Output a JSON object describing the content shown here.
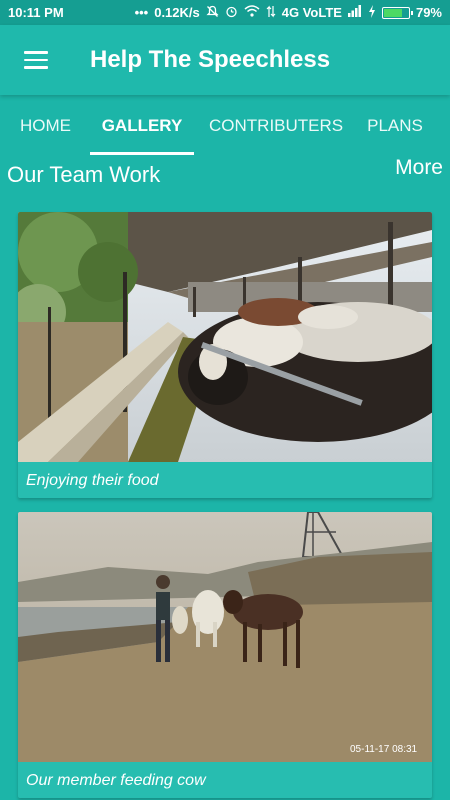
{
  "status_bar": {
    "time": "10:11 PM",
    "network_speed": "0.12K/s",
    "network_type": "4G VoLTE",
    "battery_percent": "79%",
    "battery_level": 0.79
  },
  "app_bar": {
    "title": "Help The Speechless",
    "menu_icon": "hamburger-menu-icon"
  },
  "tabs": [
    {
      "label": "HOME",
      "active": false
    },
    {
      "label": "GALLERY",
      "active": true
    },
    {
      "label": "CONTRIBUTERS",
      "active": false
    },
    {
      "label": "PLANS",
      "active": false
    }
  ],
  "gallery": {
    "section_title": "Our Team Work",
    "more_label": "More",
    "items": [
      {
        "caption": "Enjoying their food"
      },
      {
        "caption": "Our member feeding cow",
        "photo_timestamp": "05-11-17 08:31"
      }
    ]
  },
  "colors": {
    "primary": "#1fb9ac",
    "status_bar": "#159e92",
    "background": "#1cb5a8",
    "text": "#ffffff"
  }
}
